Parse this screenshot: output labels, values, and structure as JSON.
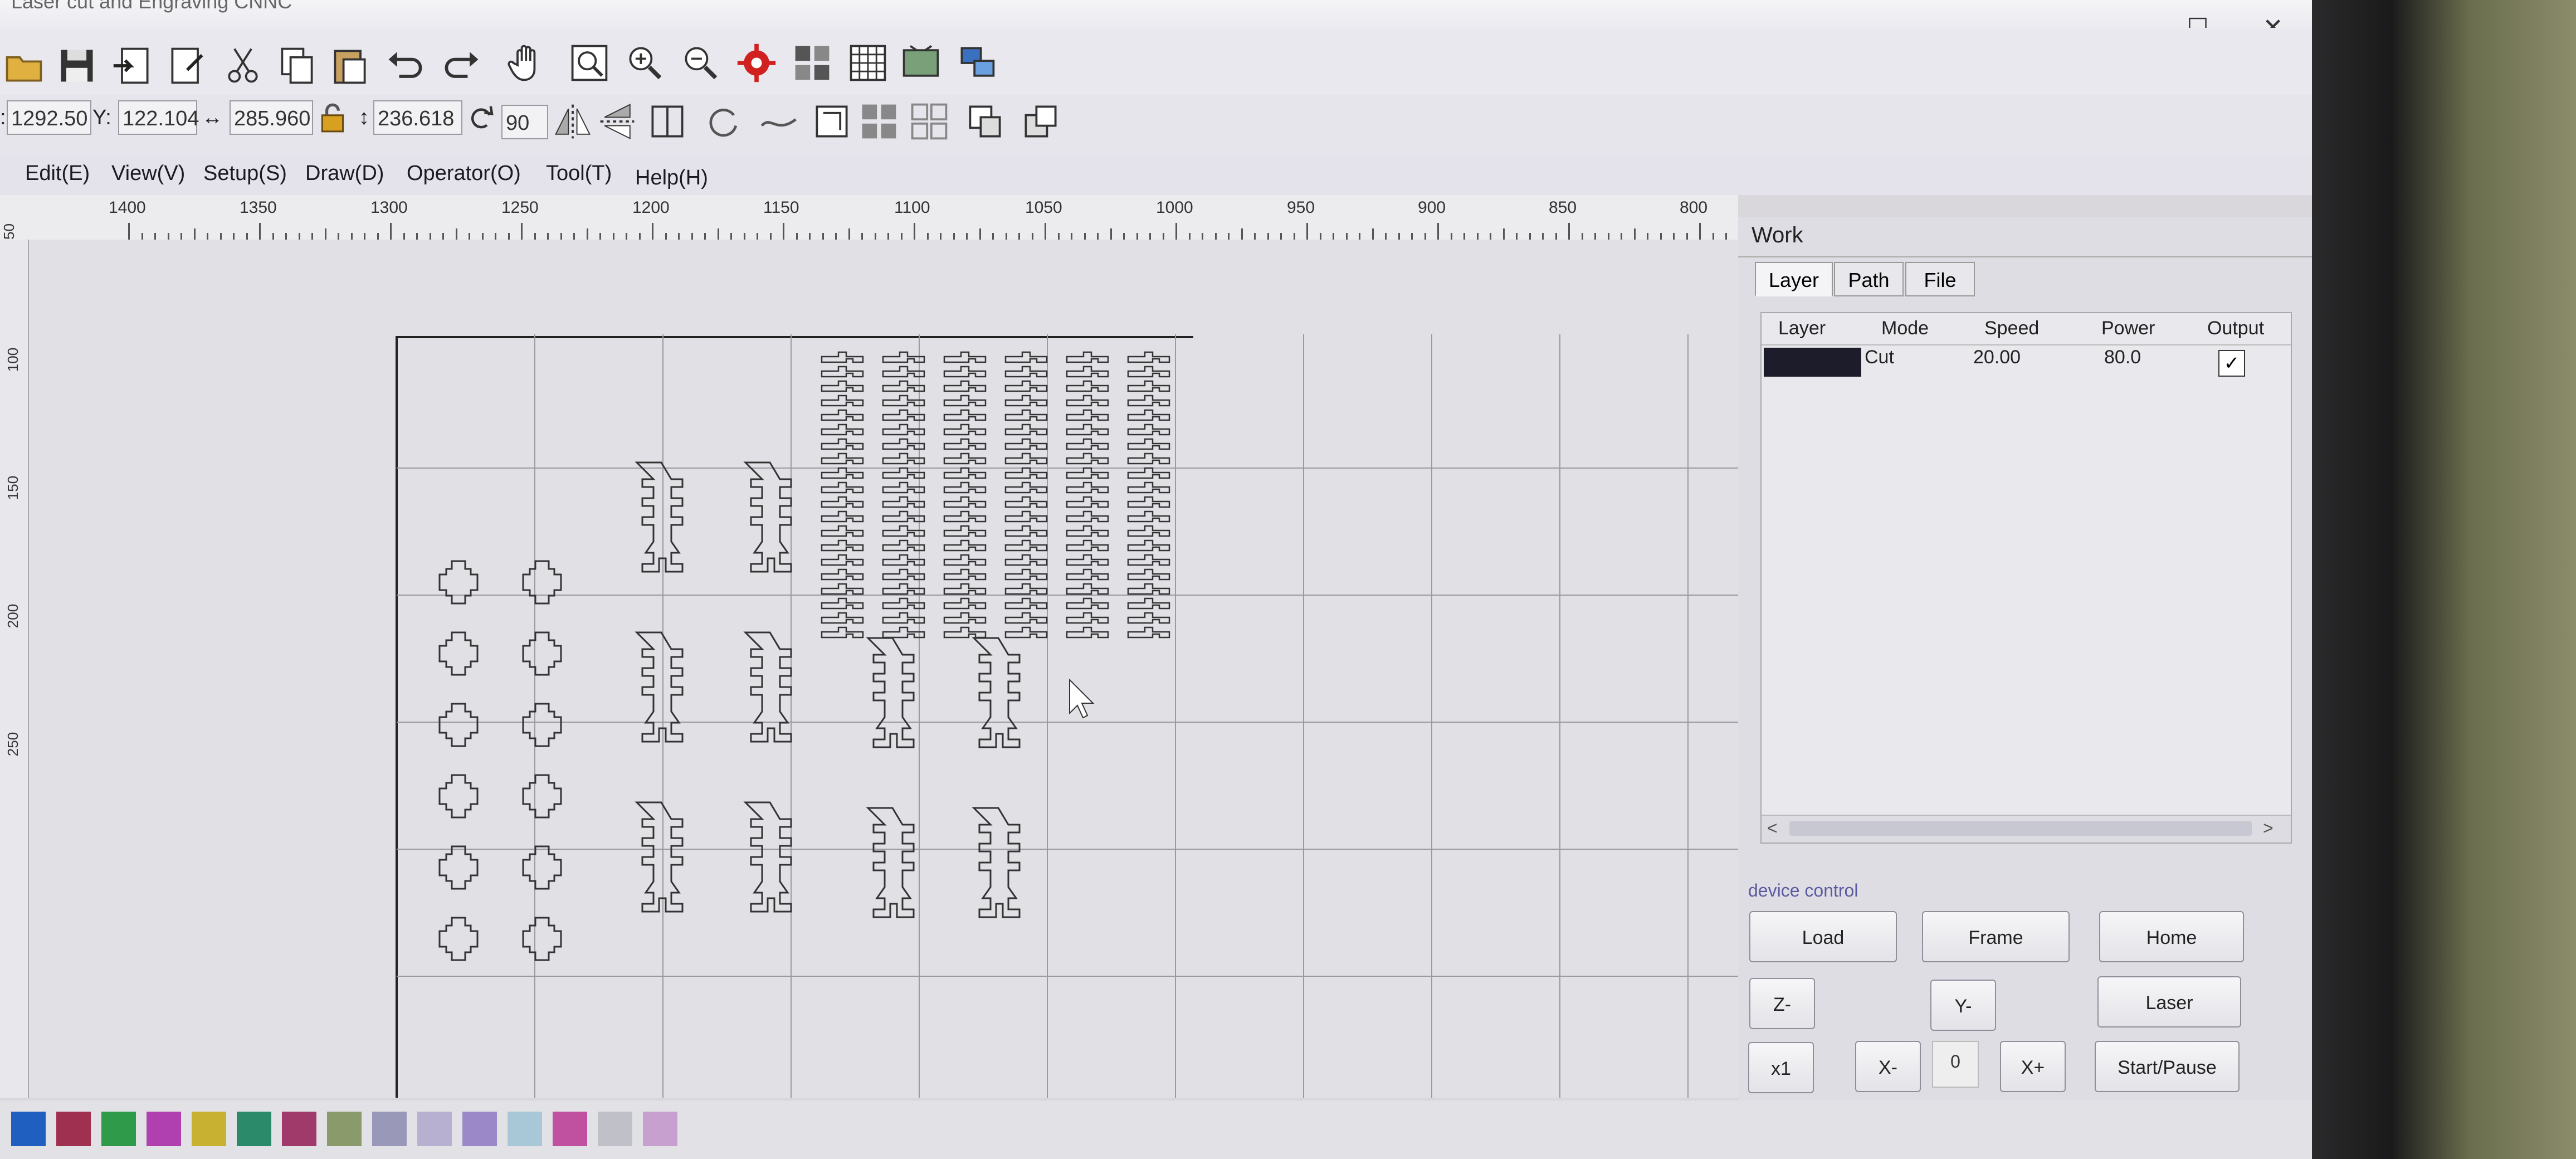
{
  "window": {
    "title": "Laser cut and Engraving CNNC",
    "buttons": {
      "minimize": "—",
      "maximize": "☐",
      "close": "✕"
    }
  },
  "toolbar1": {
    "icons": [
      "open-icon",
      "save-icon",
      "import-icon",
      "export-icon",
      "cut-icon",
      "copy-icon",
      "paste-icon",
      "undo-icon",
      "redo-icon",
      "hand-icon",
      "zoom-select-icon",
      "zoom-in-icon",
      "zoom-out-icon",
      "settings-icon",
      "array-icon",
      "grid-icon",
      "display-icon",
      "device-icon"
    ]
  },
  "toolbar2": {
    "x_label": ":",
    "x_value": "1292.50",
    "y_label": "Y:",
    "y_value": "122.104",
    "w_label": "↔",
    "w_value": "285.960",
    "h_label": "↕",
    "h_value": "236.618",
    "rotate_value": "90"
  },
  "menubar": {
    "items": [
      "Edit(E)",
      "View(V)",
      "Setup(S)",
      "Draw(D)",
      "Operator(O)",
      "Tool(T)",
      "Help(H)"
    ]
  },
  "ruler": {
    "labels": [
      "1400",
      "1350",
      "1300",
      "1250",
      "1200",
      "1150",
      "1100",
      "1050",
      "1000",
      "950",
      "900",
      "850",
      "800"
    ]
  },
  "vruler": {
    "labels": [
      "50",
      "100",
      "150",
      "200",
      "250"
    ]
  },
  "work_panel": {
    "title": "Work",
    "tabs": [
      "Layer",
      "Path",
      "File"
    ],
    "active_tab": "Layer",
    "columns": [
      "Layer",
      "Mode",
      "Speed",
      "Power",
      "Output"
    ],
    "rows": [
      {
        "layer_color": "#1c1c2a",
        "mode": "Cut",
        "speed": "20.00",
        "power": "80.0",
        "output": "✓"
      }
    ],
    "scroll_left": "<",
    "scroll_right": ">",
    "device_control_label": "device control",
    "buttons": {
      "load": "Load",
      "frame": "Frame",
      "home": "Home",
      "z_minus": "Z-",
      "y_minus": "Y-",
      "laser": "Laser",
      "x1": "x1",
      "x_minus": "X-",
      "step": "0",
      "x_plus": "X+",
      "start_pause": "Start/Pause"
    }
  },
  "palette": {
    "colors": [
      "#1f5fbf",
      "#a03050",
      "#2e9a4a",
      "#b040b0",
      "#c8b030",
      "#2a8a6a",
      "#a03a6a",
      "#8a9a6a",
      "#9a98b8",
      "#b8b0d0",
      "#9a88c8",
      "#a8c8d8",
      "#c050a0",
      "#c0c0c8",
      "#c8a0d0"
    ]
  }
}
